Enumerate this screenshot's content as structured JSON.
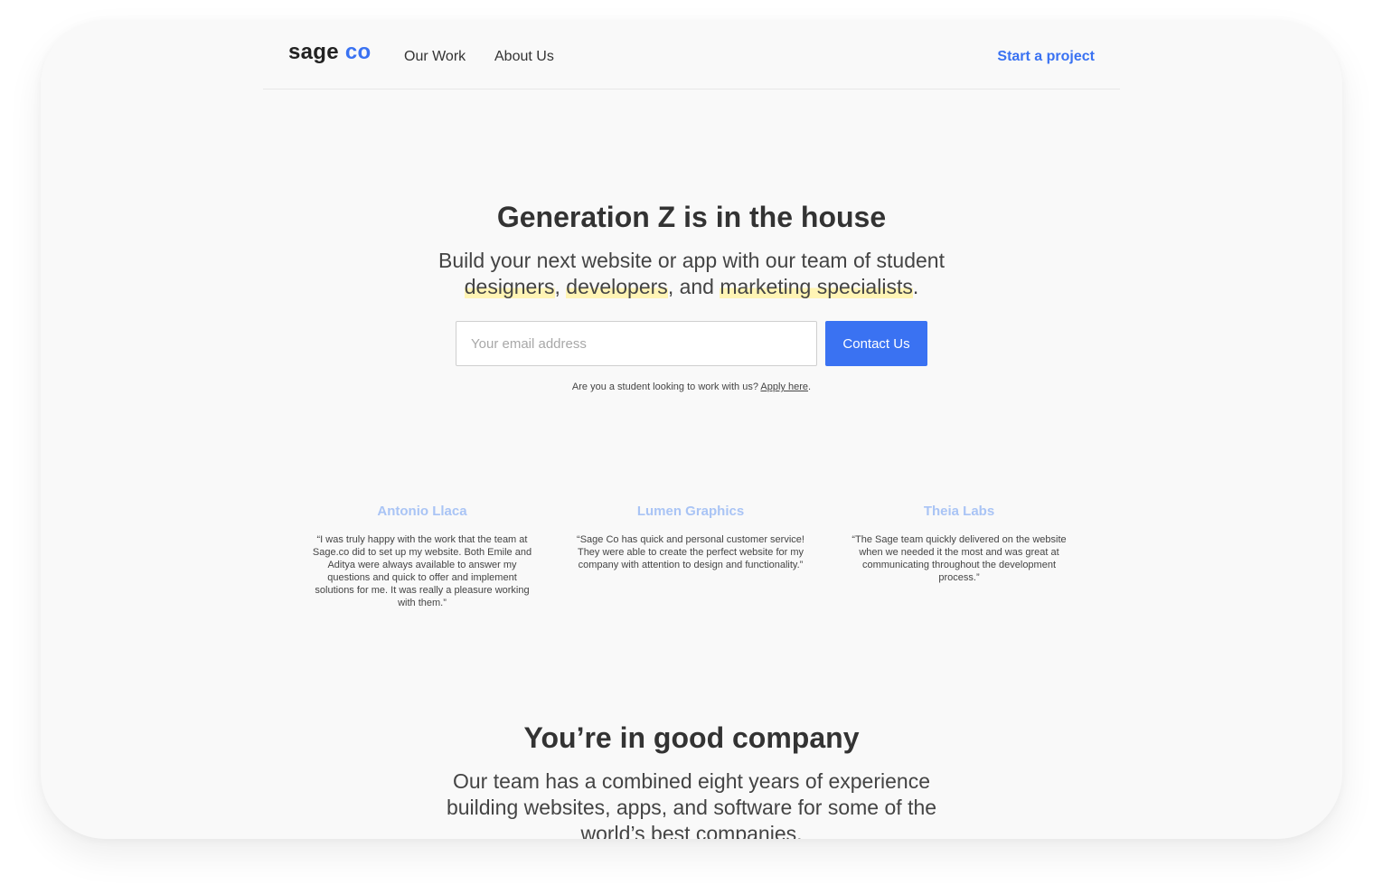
{
  "nav": {
    "logo_main": "sage",
    "logo_accent": "co",
    "links": [
      "Our Work",
      "About Us"
    ],
    "cta": "Start a project"
  },
  "hero": {
    "title": "Generation Z is in the house",
    "lead_prefix": "Build your next website or app with our team of student",
    "roles": [
      "designers",
      "developers",
      "marketing specialists"
    ],
    "sep1": ", ",
    "sep2": ", and ",
    "end": ".",
    "email_placeholder": "Your email address",
    "submit_label": "Contact Us",
    "apply_prefix": "Are you a student looking to work with us?",
    "apply_link": "Apply here",
    "apply_suffix": "."
  },
  "testimonials": [
    {
      "name": "Antonio Llaca",
      "quote": "“I was truly happy with the work that the team at Sage.co did to set up my website. Both Emile and Aditya were always available to answer my questions and quick to offer and implement solutions for me. It was really a pleasure working with them.”"
    },
    {
      "name": "Lumen Graphics",
      "quote": "“Sage Co has quick and personal customer service! They were able to create the perfect website for my company with attention to design and functionality.”"
    },
    {
      "name": "Theia Labs",
      "quote": "“The Sage team quickly delivered on the website when we needed it the most and was great at communicating throughout the development process.”"
    }
  ],
  "company": {
    "title": "You’re in good company",
    "lead": "Our team has a combined eight years of experience building websites, apps, and software for some of the world’s best companies."
  },
  "colors": {
    "accent": "#3a72f2",
    "highlight": "#fff4b5",
    "testimonial_name": "#a9c4f5"
  }
}
